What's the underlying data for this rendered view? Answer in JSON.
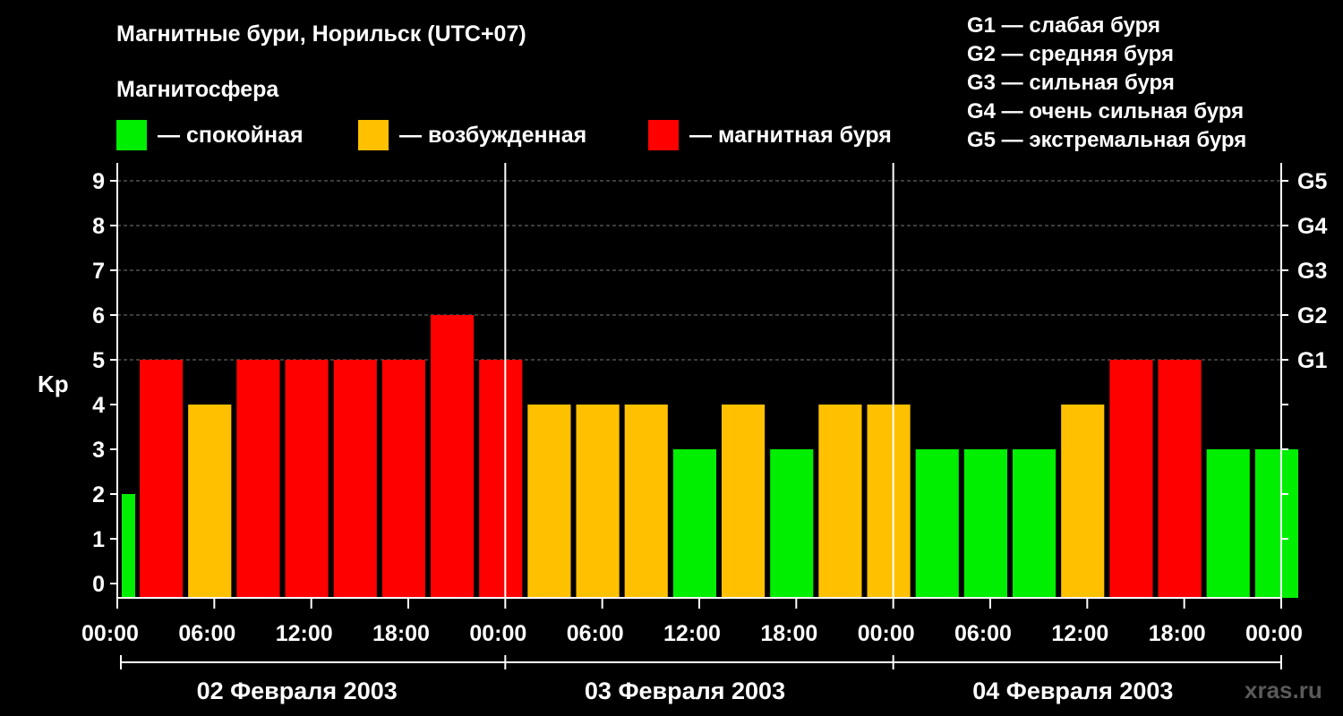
{
  "title": "Магнитные бури, Норильск (UTC+07)",
  "subtitle": "Магнитосфера",
  "legend": [
    {
      "label": "— спокойная",
      "color": "#00ee00"
    },
    {
      "label": "— возбужденная",
      "color": "#ffc000"
    },
    {
      "label": "— магнитная буря",
      "color": "#ff0000"
    }
  ],
  "g_scale": [
    "G1 — слабая буря",
    "G2 — средняя буря",
    "G3 — сильная буря",
    "G4 — очень сильная буря",
    "G5 — экстремальная буря"
  ],
  "credit": "xras.ru",
  "chart_data": {
    "type": "bar",
    "ylabel": "Kp",
    "ylim": [
      0,
      9
    ],
    "yticks": [
      "0",
      "1",
      "2",
      "3",
      "4",
      "5",
      "6",
      "7",
      "8",
      "9"
    ],
    "right_ticks": [
      {
        "kp": 5,
        "label": "G1"
      },
      {
        "kp": 6,
        "label": "G2"
      },
      {
        "kp": 7,
        "label": "G3"
      },
      {
        "kp": 8,
        "label": "G4"
      },
      {
        "kp": 9,
        "label": "G5"
      }
    ],
    "x_tick_labels": [
      "00:00",
      "06:00",
      "12:00",
      "18:00",
      "00:00",
      "06:00",
      "12:00",
      "18:00",
      "00:00",
      "06:00",
      "12:00",
      "18:00",
      "00:00"
    ],
    "days": [
      "02 Февраля 2003",
      "03 Февраля 2003",
      "04 Февраля 2003"
    ],
    "grid": "dashed horizontal at 5–9",
    "color_thresholds": {
      "quiet_max": 3,
      "active_max": 4
    },
    "bars_per_day": 8,
    "first_bar_partial": true,
    "values": [
      2,
      5,
      4,
      5,
      5,
      5,
      5,
      6,
      5,
      4,
      4,
      4,
      3,
      4,
      3,
      4,
      4,
      3,
      3,
      3,
      4,
      5,
      5,
      3,
      3
    ]
  }
}
